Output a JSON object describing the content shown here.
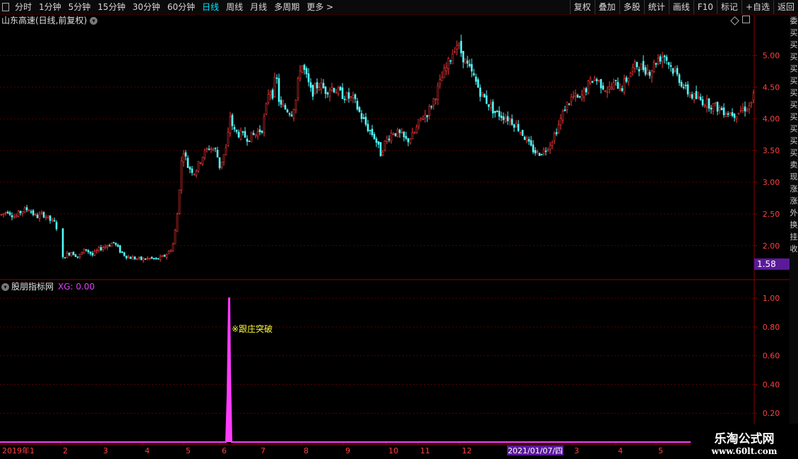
{
  "toolbar": {
    "left_items": [
      "分时",
      "1分钟",
      "5分钟",
      "15分钟",
      "30分钟",
      "60分钟",
      "日线",
      "周线",
      "月线",
      "多周期",
      "更多 >"
    ],
    "active_item": "日线",
    "right_items": [
      "复权",
      "叠加",
      "多股",
      "统计",
      "画线",
      "F10",
      "标记",
      "+自选",
      "返回"
    ]
  },
  "chart_header": {
    "stock_title": "山东高速(日线,前复权)"
  },
  "indicator_header": {
    "name": "股朋指标网",
    "value_text": "XG: 0.00"
  },
  "sidebar_chars": [
    "委",
    "买",
    "买",
    "买",
    "买",
    "买",
    "买",
    "买",
    "买",
    "买",
    "买",
    "买",
    "卖",
    "现",
    "涨",
    "涨",
    "外",
    "换",
    "挂",
    "收",
    "",
    "",
    "",
    "",
    "",
    "",
    "",
    "",
    "",
    "",
    "",
    "",
    "",
    "",
    "",
    "",
    ""
  ],
  "current_price_tag": "1.58",
  "colors": {
    "up": "#ff3a3a",
    "down": "#54fcfc",
    "axis": "#8b0000",
    "grid": "#5a0000",
    "indicator": "#ff3cff",
    "annotation": "#ffff3c",
    "date_highlight": "#5a1a9a"
  },
  "watermark": {
    "line1": "乐淘公式网",
    "line2": "www.60lt.com"
  },
  "chart_data": [
    {
      "type": "candlestick",
      "title": "山东高速(日线,前复权)",
      "y_ticks": [
        2.0,
        2.5,
        3.0,
        3.5,
        4.0,
        4.5,
        5.0
      ],
      "ylim": [
        1.53,
        5.45
      ],
      "grid": true,
      "x_axis_labels": [
        "2019年1",
        "2",
        "3",
        "4",
        "5",
        "6",
        "7",
        "8",
        "9",
        "10",
        "11",
        "12",
        "2021/01/07/四",
        "3",
        "4",
        "5"
      ],
      "close_path_anchors": [
        [
          0,
          2.48
        ],
        [
          10,
          2.55
        ],
        [
          20,
          2.45
        ],
        [
          30,
          2.55
        ],
        [
          40,
          2.58
        ],
        [
          50,
          2.45
        ],
        [
          60,
          2.5
        ],
        [
          70,
          2.4
        ],
        [
          78,
          2.35
        ],
        [
          83,
          2.05
        ],
        [
          84,
          1.75
        ],
        [
          92,
          1.85
        ],
        [
          100,
          1.9
        ],
        [
          110,
          1.82
        ],
        [
          120,
          1.95
        ],
        [
          130,
          1.85
        ],
        [
          140,
          1.95
        ],
        [
          150,
          2.0
        ],
        [
          160,
          2.05
        ],
        [
          170,
          1.9
        ],
        [
          180,
          1.82
        ],
        [
          190,
          1.8
        ],
        [
          200,
          1.78
        ],
        [
          210,
          1.8
        ],
        [
          220,
          1.78
        ],
        [
          230,
          1.82
        ],
        [
          240,
          1.92
        ],
        [
          245,
          2.05
        ],
        [
          250,
          2.5
        ],
        [
          255,
          3.2
        ],
        [
          258,
          3.55
        ],
        [
          265,
          3.25
        ],
        [
          275,
          3.15
        ],
        [
          285,
          3.4
        ],
        [
          295,
          3.55
        ],
        [
          305,
          3.5
        ],
        [
          310,
          3.25
        ],
        [
          320,
          3.55
        ],
        [
          325,
          4.05
        ],
        [
          330,
          3.8
        ],
        [
          340,
          3.75
        ],
        [
          350,
          3.7
        ],
        [
          360,
          3.75
        ],
        [
          370,
          3.85
        ],
        [
          375,
          4.1
        ],
        [
          380,
          4.5
        ],
        [
          385,
          4.4
        ],
        [
          390,
          4.7
        ],
        [
          395,
          4.2
        ],
        [
          405,
          4.15
        ],
        [
          412,
          4.1
        ],
        [
          418,
          4.3
        ],
        [
          425,
          4.9
        ],
        [
          430,
          4.75
        ],
        [
          440,
          4.4
        ],
        [
          450,
          4.55
        ],
        [
          460,
          4.45
        ],
        [
          470,
          4.5
        ],
        [
          480,
          4.4
        ],
        [
          490,
          4.35
        ],
        [
          500,
          4.3
        ],
        [
          510,
          4.05
        ],
        [
          520,
          3.85
        ],
        [
          530,
          3.7
        ],
        [
          538,
          3.45
        ],
        [
          545,
          3.65
        ],
        [
          555,
          3.8
        ],
        [
          565,
          3.75
        ],
        [
          575,
          3.65
        ],
        [
          585,
          3.75
        ],
        [
          595,
          4.0
        ],
        [
          605,
          4.1
        ],
        [
          615,
          4.35
        ],
        [
          625,
          4.65
        ],
        [
          635,
          4.9
        ],
        [
          645,
          5.2
        ],
        [
          650,
          5.1
        ],
        [
          660,
          4.85
        ],
        [
          670,
          4.65
        ],
        [
          680,
          4.4
        ],
        [
          690,
          4.25
        ],
        [
          700,
          4.1
        ],
        [
          710,
          4.05
        ],
        [
          720,
          4.0
        ],
        [
          730,
          3.9
        ],
        [
          740,
          3.75
        ],
        [
          750,
          3.55
        ],
        [
          760,
          3.45
        ],
        [
          770,
          3.5
        ],
        [
          780,
          3.65
        ],
        [
          790,
          3.9
        ],
        [
          800,
          4.2
        ],
        [
          810,
          4.35
        ],
        [
          820,
          4.3
        ],
        [
          830,
          4.5
        ],
        [
          840,
          4.65
        ],
        [
          850,
          4.55
        ],
        [
          860,
          4.45
        ],
        [
          870,
          4.55
        ],
        [
          880,
          4.5
        ],
        [
          890,
          4.7
        ],
        [
          900,
          4.85
        ],
        [
          910,
          4.8
        ],
        [
          920,
          4.75
        ],
        [
          930,
          4.95
        ],
        [
          940,
          5.0
        ],
        [
          950,
          4.8
        ],
        [
          960,
          4.65
        ],
        [
          970,
          4.45
        ],
        [
          980,
          4.35
        ],
        [
          990,
          4.3
        ],
        [
          1000,
          4.25
        ],
        [
          1010,
          4.2
        ],
        [
          1020,
          4.15
        ],
        [
          1030,
          4.1
        ],
        [
          1040,
          4.08
        ],
        [
          1050,
          4.15
        ],
        [
          1060,
          4.2
        ],
        [
          1068,
          4.4
        ]
      ]
    },
    {
      "type": "line",
      "title": "股朋指标网",
      "series": [
        {
          "name": "XG",
          "values": "0 everywhere except a single spike to 1.00 near mid-June 2020"
        }
      ],
      "y_ticks": [
        0.2,
        0.4,
        0.6,
        0.8,
        1.0
      ],
      "ylim": [
        0,
        1.05
      ],
      "annotation": {
        "text": "※跟庄突破",
        "at_x_fraction": 0.305
      }
    }
  ]
}
